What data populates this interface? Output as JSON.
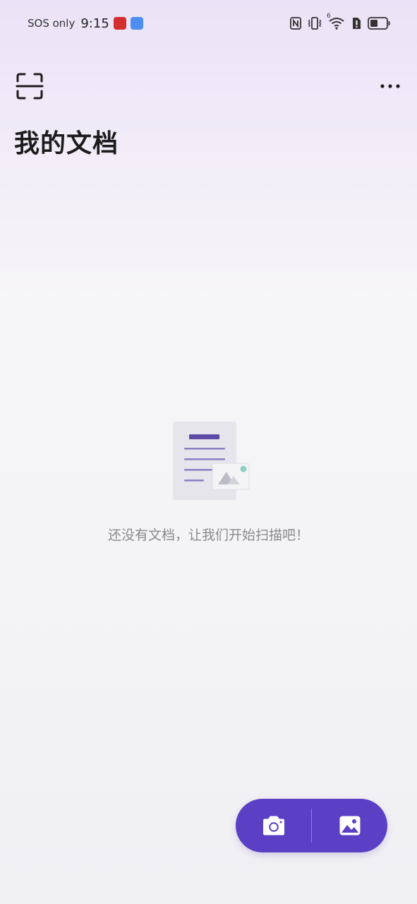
{
  "status_bar": {
    "carrier": "SOS only",
    "time": "9:15",
    "network_badge": "6"
  },
  "header": {
    "title": "我的文档",
    "scan_icon": "scan-frame-icon",
    "more_icon": "more-horizontal-icon"
  },
  "empty_state": {
    "message": "还没有文档，让我们开始扫描吧！",
    "illustration_icon": "document-image-icon"
  },
  "capture": {
    "camera_icon": "camera-icon",
    "gallery_icon": "image-gallery-icon"
  },
  "colors": {
    "accent": "#5b3fc4",
    "doc_line": "#5d4aa6",
    "doc_dot": "#8ed1c2",
    "bg_top": "#ebe2f7",
    "bg_bottom": "#f0f0f3"
  }
}
